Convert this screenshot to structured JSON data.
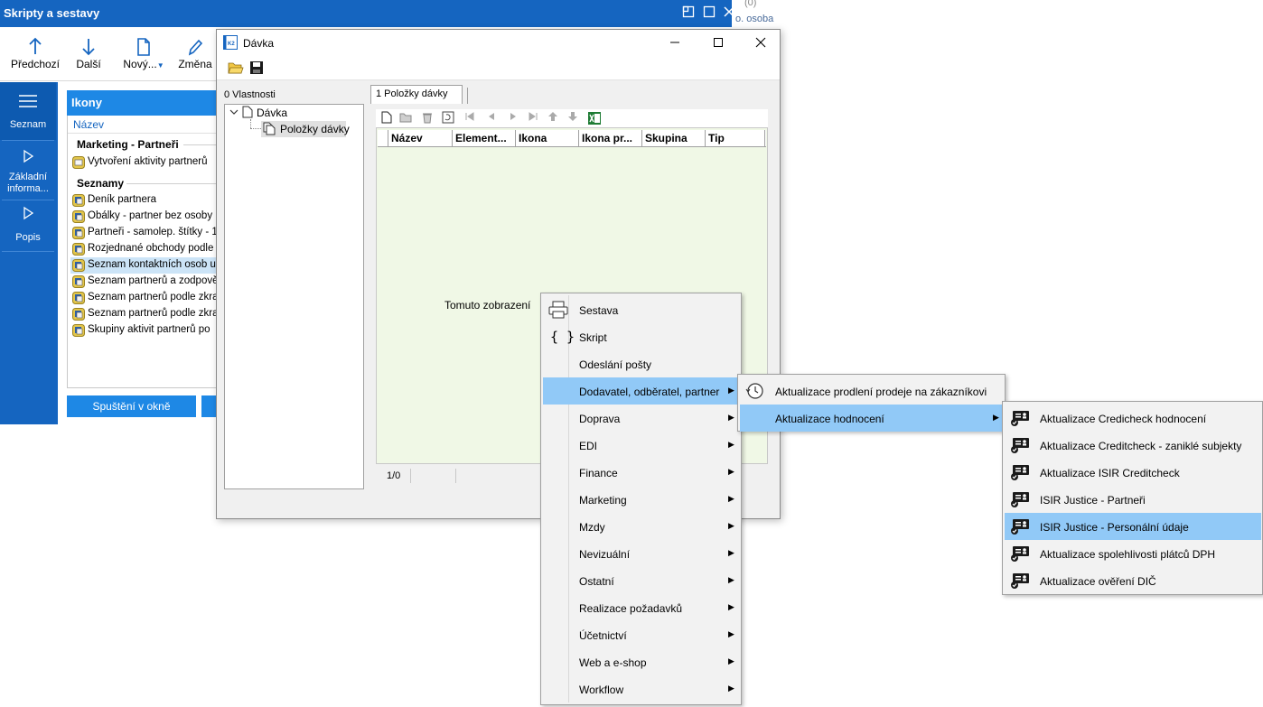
{
  "bg_window": {
    "title": "Skripty a sestavy",
    "beyond_text_top": "(0)",
    "beyond_text": "o. osoba",
    "toolbar": [
      {
        "label": "Předchozí",
        "icon": "arrow-up-icon"
      },
      {
        "label": "Další",
        "icon": "arrow-down-icon"
      },
      {
        "label": "Nový...",
        "icon": "new-document-icon"
      },
      {
        "label": "Změna",
        "icon": "pencil-icon"
      }
    ],
    "leftnav": [
      {
        "label": "Seznam",
        "icon": "list-icon"
      },
      {
        "label": "Základní informa...",
        "icon": "triangle-right-icon"
      },
      {
        "label": "Popis",
        "icon": "triangle-right-icon"
      }
    ],
    "panel": {
      "title": "Ikony",
      "column": "Název",
      "groups": [
        {
          "name": "Marketing - Partneři",
          "items": [
            "Vytvoření aktivity partnerů"
          ]
        },
        {
          "name": "Seznamy",
          "items": [
            "Deník partnera",
            "Obálky - partner bez osoby",
            "Partneři - samolep. štítky - 1",
            "Rozjednané obchody podle",
            "Seznam kontaktních osob u",
            "Seznam partnerů a zodpově",
            "Seznam partnerů podle zkra",
            "Seznam partnerů podle zkra",
            "Skupiny aktivit partnerů po"
          ]
        }
      ],
      "selected_item": "Seznam kontaktních osob u",
      "run_button": "Spuštění v okně"
    }
  },
  "dialog": {
    "title": "Dávka",
    "tree_label": "0 Vlastnosti",
    "tree": {
      "root": "Dávka",
      "child": "Položky dávky"
    },
    "tab": "1 Položky dávky",
    "columns": [
      "Název",
      "Element...",
      "Ikona",
      "Ikona pr...",
      "Skupina",
      "Tip"
    ],
    "empty_message": "Tomuto zobrazení",
    "status_count": "1/0"
  },
  "menu_main": {
    "items": [
      {
        "label": "Sestava",
        "icon": "printer-icon"
      },
      {
        "label": "Skript",
        "icon": "braces-icon"
      },
      {
        "label": "Odeslání pošty"
      },
      {
        "label": "Dodavatel, odběratel, partner",
        "submenu": true,
        "highlighted": true
      },
      {
        "label": "Doprava",
        "submenu": true
      },
      {
        "label": "EDI",
        "submenu": true
      },
      {
        "label": "Finance",
        "submenu": true
      },
      {
        "label": "Marketing",
        "submenu": true
      },
      {
        "label": "Mzdy",
        "submenu": true
      },
      {
        "label": "Nevizuální",
        "submenu": true
      },
      {
        "label": "Ostatní",
        "submenu": true
      },
      {
        "label": "Realizace požadavků",
        "submenu": true
      },
      {
        "label": "Účetnictví",
        "submenu": true
      },
      {
        "label": "Web a e-shop",
        "submenu": true
      },
      {
        "label": "Workflow",
        "submenu": true
      }
    ]
  },
  "menu_sub1": {
    "items": [
      {
        "label": "Aktualizace prodlení prodeje na zákazníkovi",
        "icon": "clock-history-icon"
      },
      {
        "label": "Aktualizace hodnocení",
        "submenu": true,
        "highlighted": true
      }
    ]
  },
  "menu_sub2": {
    "items": [
      {
        "label": "Aktualizace Credicheck hodnocení"
      },
      {
        "label": "Aktualizace Creditcheck - zaniklé subjekty"
      },
      {
        "label": "Aktualizace ISIR Creditcheck"
      },
      {
        "label": "ISIR Justice - Partneři"
      },
      {
        "label": "ISIR Justice - Personální údaje",
        "highlighted": true
      },
      {
        "label": "Aktualizace spolehlivosti plátců DPH"
      },
      {
        "label": "Aktualizace ověření DIČ"
      }
    ]
  },
  "colors": {
    "accent": "#1565c0",
    "panel_header": "#1e88e5",
    "menu_highlight": "#91c9f7",
    "grid_background": "#f0f8e6"
  }
}
